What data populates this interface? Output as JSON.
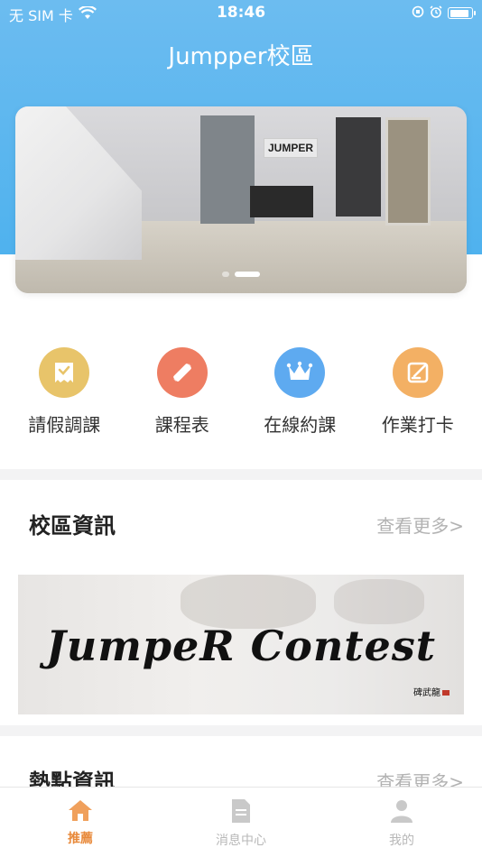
{
  "status_bar": {
    "carrier": "无 SIM 卡",
    "time": "18:46",
    "battery_level": 0.92
  },
  "header": {
    "title": "Jumpper校區"
  },
  "banner": {
    "logo_text": "JUMPER",
    "slide_count": 2,
    "active_slide": 2
  },
  "menu": [
    {
      "label": "請假調課",
      "icon": "leave-ticket-icon",
      "color": "#e8c46a"
    },
    {
      "label": "課程表",
      "icon": "pencil-ruler-icon",
      "color": "#ee7d62"
    },
    {
      "label": "在線約課",
      "icon": "crown-icon",
      "color": "#5eaaf0"
    },
    {
      "label": "作業打卡",
      "icon": "edit-note-icon",
      "color": "#f3b064"
    }
  ],
  "campus_news": {
    "title": "校區資訊",
    "more_label": "查看更多>",
    "card_text": "JumpeR Contest",
    "card_seal": "碑武龍"
  },
  "hot_news": {
    "title": "熱點資訊",
    "more_label": "查看更多>"
  },
  "tabbar": [
    {
      "label": "推薦",
      "icon": "home-icon",
      "active": true
    },
    {
      "label": "消息中心",
      "icon": "document-icon",
      "active": false
    },
    {
      "label": "我的",
      "icon": "person-icon",
      "active": false
    }
  ],
  "colors": {
    "header_blue": "#5eb6ef",
    "accent_orange": "#e8893a",
    "muted_gray": "#b2b2b2"
  }
}
